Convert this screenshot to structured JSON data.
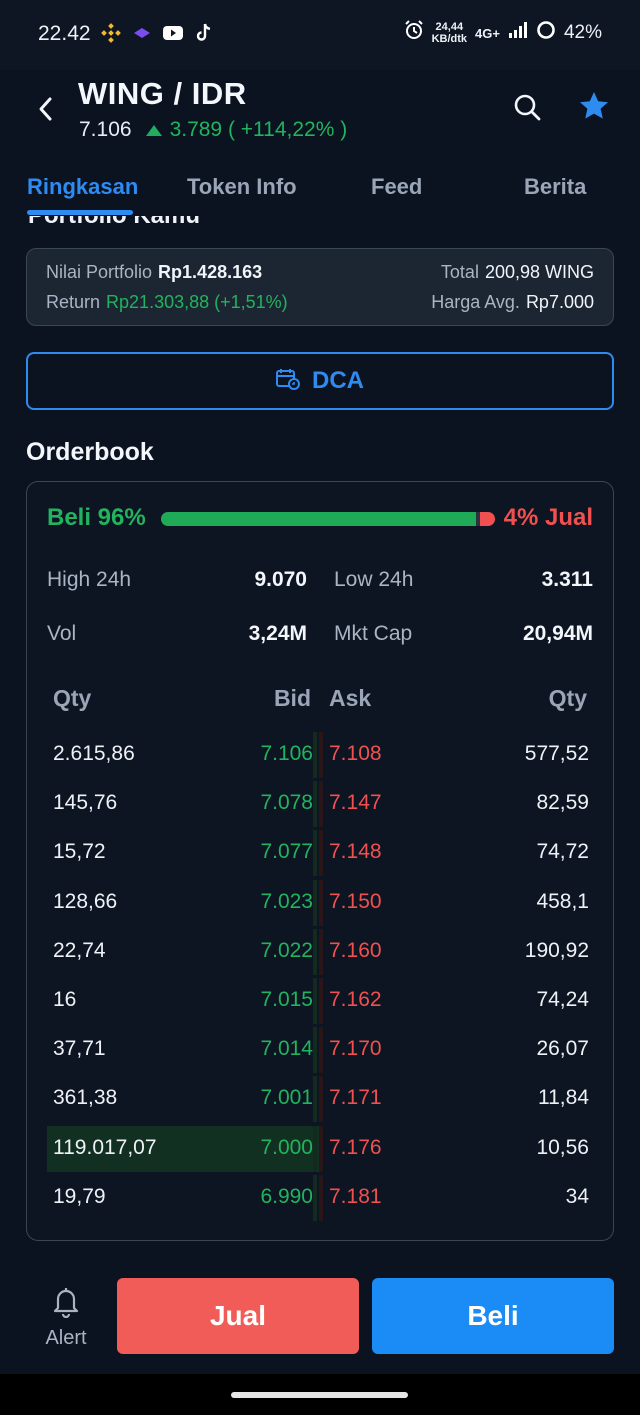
{
  "status_bar": {
    "time": "22.42",
    "speed_top": "24,44",
    "speed_bottom": "KB/dtk",
    "network": "4G+",
    "battery": "42%"
  },
  "header": {
    "pair": "WING / IDR",
    "price": "7.106",
    "change": "3.789 ( +114,22% )"
  },
  "tabs": [
    "Ringkasan",
    "Token Info",
    "Feed",
    "Berita"
  ],
  "section_partial_title": "Portfolio Kamu",
  "portfolio": {
    "nilai_label": "Nilai Portfolio",
    "nilai_value": "Rp1.428.163",
    "total_label": "Total",
    "total_value": "200,98 WING",
    "return_label": "Return",
    "return_value": "Rp21.303,88 (+1,51%)",
    "harga_label": "Harga Avg.",
    "harga_value": "Rp7.000"
  },
  "dca": {
    "label": "DCA"
  },
  "orderbook": {
    "title": "Orderbook",
    "beli_label": "Beli 96%",
    "jual_label": "4% Jual",
    "buy_ratio": 0.96,
    "stats": {
      "high_label": "High 24h",
      "high_value": "9.070",
      "low_label": "Low 24h",
      "low_value": "3.311",
      "vol_label": "Vol",
      "vol_value": "3,24M",
      "mcap_label": "Mkt Cap",
      "mcap_value": "20,94M"
    },
    "headers": {
      "qty_bid": "Qty",
      "bid": "Bid",
      "ask": "Ask",
      "qty_ask": "Qty"
    },
    "rows": [
      {
        "qty_bid": "2.615,86",
        "bid": "7.106",
        "ask": "7.108",
        "qty_ask": "577,52"
      },
      {
        "qty_bid": "145,76",
        "bid": "7.078",
        "ask": "7.147",
        "qty_ask": "82,59"
      },
      {
        "qty_bid": "15,72",
        "bid": "7.077",
        "ask": "7.148",
        "qty_ask": "74,72"
      },
      {
        "qty_bid": "128,66",
        "bid": "7.023",
        "ask": "7.150",
        "qty_ask": "458,1"
      },
      {
        "qty_bid": "22,74",
        "bid": "7.022",
        "ask": "7.160",
        "qty_ask": "190,92"
      },
      {
        "qty_bid": "16",
        "bid": "7.015",
        "ask": "7.162",
        "qty_ask": "74,24"
      },
      {
        "qty_bid": "37,71",
        "bid": "7.014",
        "ask": "7.170",
        "qty_ask": "26,07"
      },
      {
        "qty_bid": "361,38",
        "bid": "7.001",
        "ask": "7.171",
        "qty_ask": "11,84"
      },
      {
        "qty_bid": "119.017,07",
        "bid": "7.000",
        "ask": "7.176",
        "qty_ask": "10,56"
      },
      {
        "qty_bid": "19,79",
        "bid": "6.990",
        "ask": "7.181",
        "qty_ask": "34"
      }
    ]
  },
  "bottom": {
    "alert_label": "Alert",
    "sell_label": "Jual",
    "buy_label": "Beli"
  }
}
